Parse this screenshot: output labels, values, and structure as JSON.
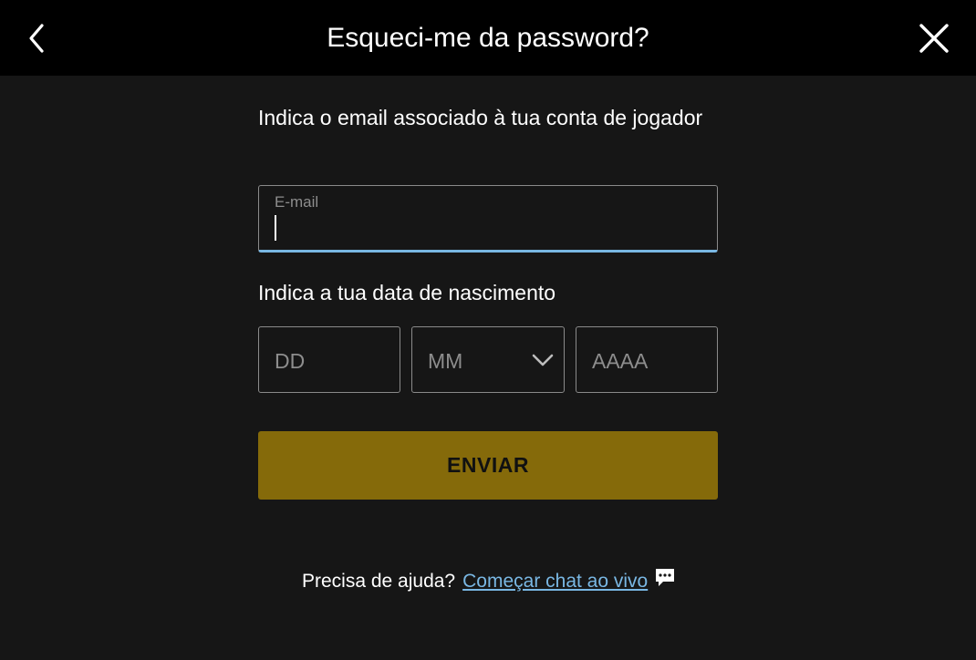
{
  "header": {
    "title": "Esqueci-me da password?",
    "back_icon": "chevron-left-icon",
    "close_icon": "close-icon"
  },
  "form": {
    "email_prompt": "Indica o email associado à tua conta de jogador",
    "email_floating_label": "E-mail",
    "email_value": "",
    "dob_prompt": "Indica a tua data de nascimento",
    "day_placeholder": "DD",
    "month_placeholder": "MM",
    "year_placeholder": "AAAA",
    "submit_label": "ENVIAR"
  },
  "help": {
    "question": "Precisa de ajuda?",
    "link_label": "Começar chat ao vivo",
    "icon": "chat-bubble-icon"
  },
  "colors": {
    "header_bg": "#000000",
    "page_bg": "#161616",
    "accent_gold": "#856a0a",
    "focus_blue": "#79b7e3"
  }
}
